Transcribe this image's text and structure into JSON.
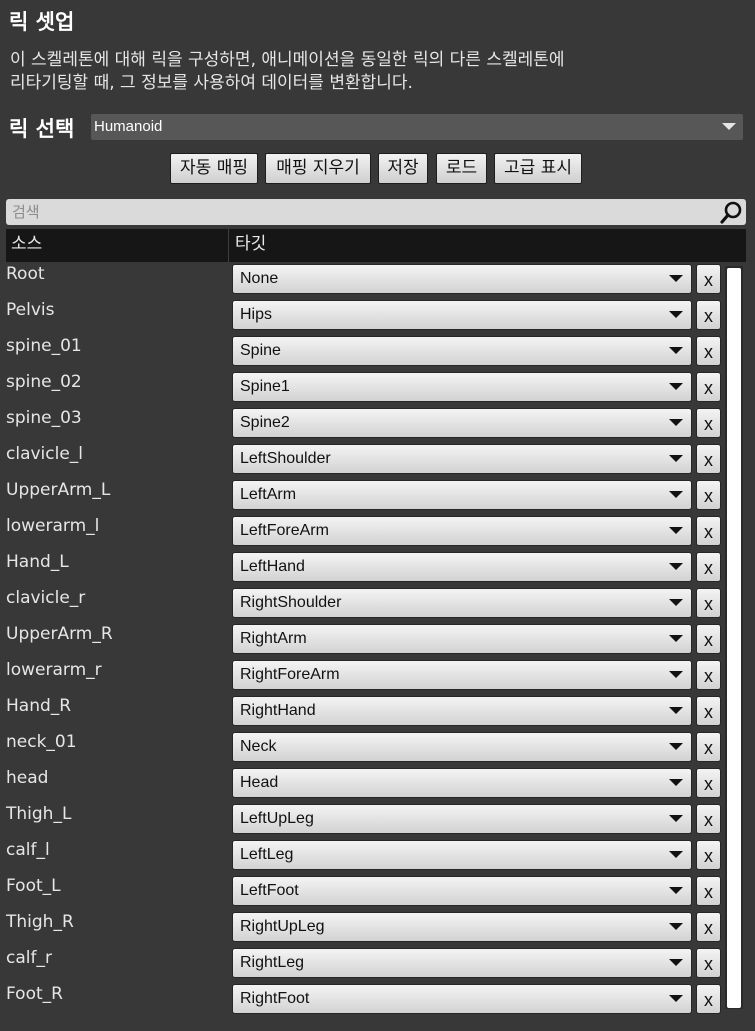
{
  "title": "릭 셋업",
  "description": [
    "이 스켈레톤에 대해 릭을 구성하면, 애니메이션을 동일한 릭의 다른 스켈레톤에",
    "리타기팅할 때, 그 정보를 사용하여 데이터를 변환합니다."
  ],
  "rig": {
    "label": "릭 선택",
    "value": "Humanoid"
  },
  "buttons": {
    "auto_map": "자동 매핑",
    "clear_map": "매핑 지우기",
    "save": "저장",
    "load": "로드",
    "advanced": "고급 표시"
  },
  "search": {
    "placeholder": "검색",
    "value": "",
    "icon": "search-icon"
  },
  "table": {
    "source_header": "소스",
    "target_header": "타깃",
    "clear_label": "x",
    "rows": [
      {
        "source": "Root",
        "target": "None"
      },
      {
        "source": "Pelvis",
        "target": "Hips"
      },
      {
        "source": "spine_01",
        "target": "Spine"
      },
      {
        "source": "spine_02",
        "target": "Spine1"
      },
      {
        "source": "spine_03",
        "target": "Spine2"
      },
      {
        "source": "clavicle_l",
        "target": "LeftShoulder"
      },
      {
        "source": "UpperArm_L",
        "target": "LeftArm"
      },
      {
        "source": "lowerarm_l",
        "target": "LeftForeArm"
      },
      {
        "source": "Hand_L",
        "target": "LeftHand"
      },
      {
        "source": "clavicle_r",
        "target": "RightShoulder"
      },
      {
        "source": "UpperArm_R",
        "target": "RightArm"
      },
      {
        "source": "lowerarm_r",
        "target": "RightForeArm"
      },
      {
        "source": "Hand_R",
        "target": "RightHand"
      },
      {
        "source": "neck_01",
        "target": "Neck"
      },
      {
        "source": "head",
        "target": "Head"
      },
      {
        "source": "Thigh_L",
        "target": "LeftUpLeg"
      },
      {
        "source": "calf_l",
        "target": "LeftLeg"
      },
      {
        "source": "Foot_L",
        "target": "LeftFoot"
      },
      {
        "source": "Thigh_R",
        "target": "RightUpLeg"
      },
      {
        "source": "calf_r",
        "target": "RightLeg"
      },
      {
        "source": "Foot_R",
        "target": "RightFoot"
      }
    ]
  }
}
